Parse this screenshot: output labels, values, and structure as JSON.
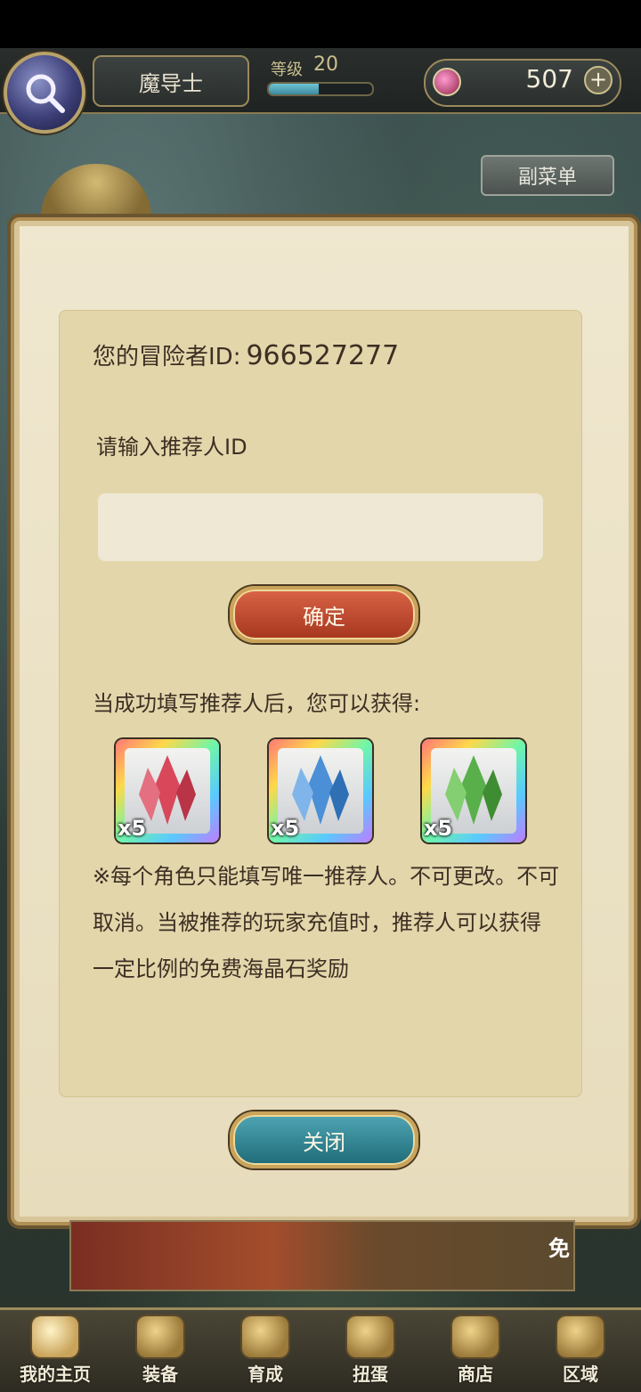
{
  "header": {
    "class_name": "魔导士",
    "level_label": "等级",
    "level_value": "20",
    "exp_progress": 0.48,
    "gem_count": "507"
  },
  "submenu_label": "副菜单",
  "dialog": {
    "adventurer_id_label": "您的冒险者ID:",
    "adventurer_id": "966527277",
    "referrer_input_label": "请输入推荐人ID",
    "referrer_input_value": "",
    "confirm_label": "确定",
    "reward_intro": "当成功填写推荐人后，您可以获得:",
    "rewards": [
      {
        "name": "red-crystal",
        "color": "#d9475a",
        "quantity": "x5"
      },
      {
        "name": "blue-crystal",
        "color": "#4b8fd6",
        "quantity": "x5"
      },
      {
        "name": "green-crystal",
        "color": "#59b04a",
        "quantity": "x5"
      }
    ],
    "notice": "※每个角色只能填写唯一推荐人。不可更改。不可取消。当被推荐的玩家充值时，推荐人可以获得一定比例的免费海晶石奖励",
    "close_label": "关闭"
  },
  "banner": {
    "free_text": "免"
  },
  "nav": {
    "items": [
      {
        "label": "我的主页"
      },
      {
        "label": "装备"
      },
      {
        "label": "育成"
      },
      {
        "label": "扭蛋"
      },
      {
        "label": "商店"
      },
      {
        "label": "区域"
      }
    ]
  }
}
